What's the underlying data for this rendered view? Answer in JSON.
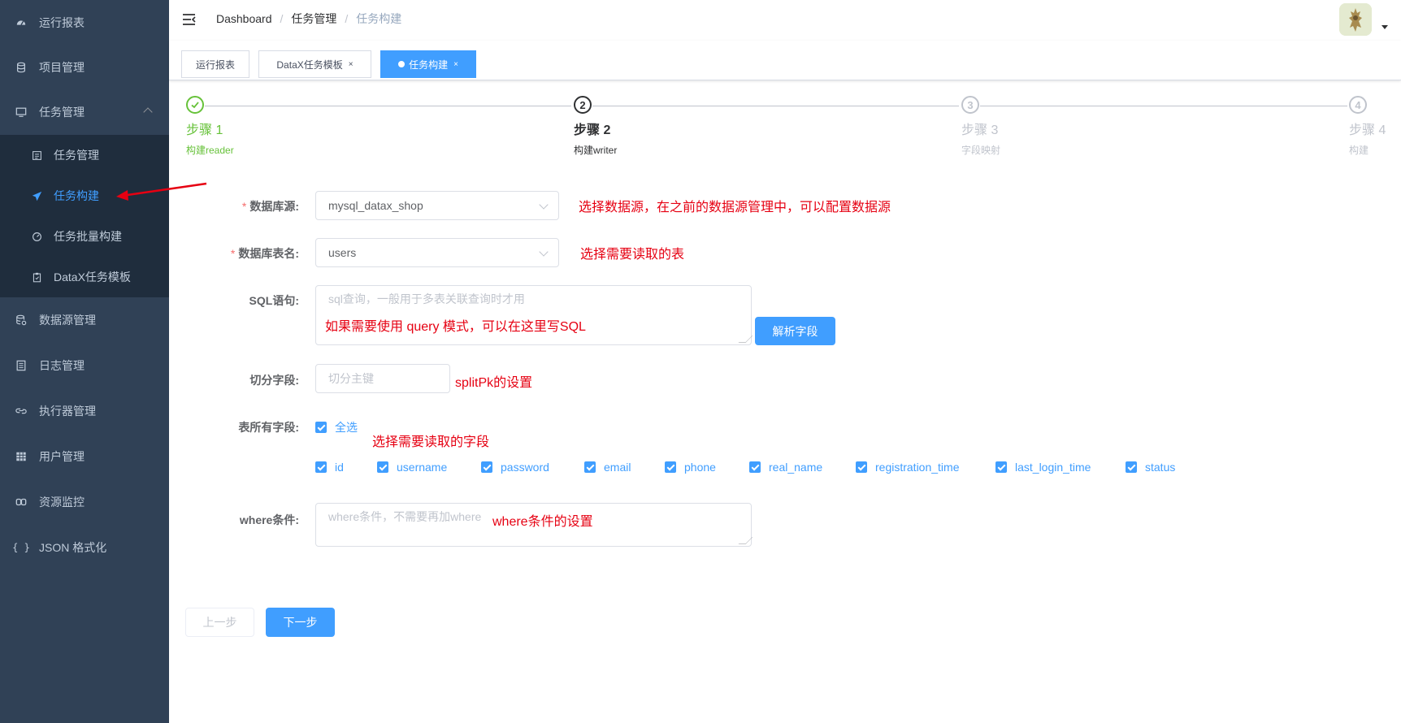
{
  "sidebar": {
    "items": [
      {
        "label": "运行报表",
        "icon": "dashboard-icon"
      },
      {
        "label": "项目管理",
        "icon": "database-icon"
      },
      {
        "label": "任务管理",
        "icon": "monitor-icon"
      },
      {
        "label": "数据源管理",
        "icon": "datasource-icon"
      },
      {
        "label": "日志管理",
        "icon": "document-icon"
      },
      {
        "label": "执行器管理",
        "icon": "link-icon"
      },
      {
        "label": "用户管理",
        "icon": "table-icon"
      },
      {
        "label": "资源监控",
        "icon": "monitor-link-icon"
      },
      {
        "label": "JSON 格式化",
        "icon": "braces-icon"
      }
    ],
    "sub_items": [
      {
        "label": "任务管理",
        "icon": "calendar-icon"
      },
      {
        "label": "任务构建",
        "icon": "send-icon",
        "active": true
      },
      {
        "label": "任务批量构建",
        "icon": "gauge-icon"
      },
      {
        "label": "DataX任务模板",
        "icon": "clipboard-icon"
      }
    ]
  },
  "navbar": {
    "breadcrumb": [
      "Dashboard",
      "任务管理",
      "任务构建"
    ],
    "breadcrumb_sep": "/"
  },
  "tags": [
    {
      "label": "运行报表"
    },
    {
      "label": "DataX任务模板",
      "close": "×"
    },
    {
      "label": "任务构建",
      "close": "×",
      "active": true
    }
  ],
  "steps": [
    {
      "num": "1",
      "title": "步骤 1",
      "desc": "构建reader",
      "status": "finish"
    },
    {
      "num": "2",
      "title": "步骤 2",
      "desc": "构建writer",
      "status": "process"
    },
    {
      "num": "3",
      "title": "步骤 3",
      "desc": "字段映射",
      "status": "wait"
    },
    {
      "num": "4",
      "title": "步骤 4",
      "desc": "构建",
      "status": "wait"
    }
  ],
  "form": {
    "datasource_label": "数据库源:",
    "datasource_value": "mysql_datax_shop",
    "table_label": "数据库表名:",
    "table_value": "users",
    "sql_label": "SQL语句:",
    "sql_placeholder": "sql查询，一般用于多表关联查询时才用",
    "parse_button": "解析字段",
    "split_label": "切分字段:",
    "split_placeholder": "切分主键",
    "fields_label": "表所有字段:",
    "select_all": "全选",
    "fields": [
      "id",
      "username",
      "password",
      "email",
      "phone",
      "real_name",
      "registration_time",
      "last_login_time",
      "status"
    ],
    "where_label": "where条件:",
    "where_placeholder": "where条件，不需要再加where",
    "required_mark": "*"
  },
  "buttons": {
    "prev": "上一步",
    "next": "下一步"
  },
  "annotations": {
    "datasource": "选择数据源，在之前的数据源管理中，可以配置数据源",
    "table": "选择需要读取的表",
    "sql": "如果需要使用 query 模式，可以在这里写SQL",
    "split": "splitPk的设置",
    "fields": "选择需要读取的字段",
    "where": "where条件的设置"
  },
  "colors": {
    "sidebar_bg": "#304156",
    "submenu_bg": "#1f2d3d",
    "primary": "#409eff",
    "success": "#67c23a",
    "annotation": "#e60012"
  }
}
